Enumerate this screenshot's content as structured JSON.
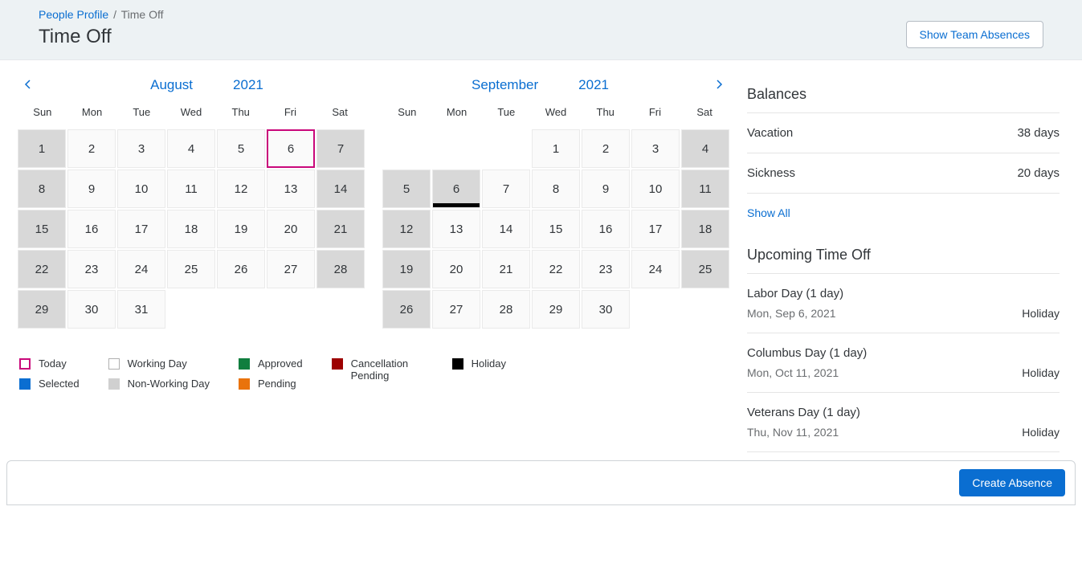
{
  "breadcrumb": {
    "parent": "People Profile",
    "current": "Time Off"
  },
  "page_title": "Time Off",
  "show_team_btn": "Show Team Absences",
  "dow": [
    "Sun",
    "Mon",
    "Tue",
    "Wed",
    "Thu",
    "Fri",
    "Sat"
  ],
  "months": [
    {
      "name": "August",
      "year": "2021",
      "weeks": [
        [
          {
            "d": 1,
            "t": "nonwork"
          },
          {
            "d": 2,
            "t": "work"
          },
          {
            "d": 3,
            "t": "work"
          },
          {
            "d": 4,
            "t": "work"
          },
          {
            "d": 5,
            "t": "work"
          },
          {
            "d": 6,
            "t": "today"
          },
          {
            "d": 7,
            "t": "nonwork"
          }
        ],
        [
          {
            "d": 8,
            "t": "nonwork"
          },
          {
            "d": 9,
            "t": "work"
          },
          {
            "d": 10,
            "t": "work"
          },
          {
            "d": 11,
            "t": "work"
          },
          {
            "d": 12,
            "t": "work"
          },
          {
            "d": 13,
            "t": "work"
          },
          {
            "d": 14,
            "t": "nonwork"
          }
        ],
        [
          {
            "d": 15,
            "t": "nonwork"
          },
          {
            "d": 16,
            "t": "work"
          },
          {
            "d": 17,
            "t": "work"
          },
          {
            "d": 18,
            "t": "work"
          },
          {
            "d": 19,
            "t": "work"
          },
          {
            "d": 20,
            "t": "work"
          },
          {
            "d": 21,
            "t": "nonwork"
          }
        ],
        [
          {
            "d": 22,
            "t": "nonwork"
          },
          {
            "d": 23,
            "t": "work"
          },
          {
            "d": 24,
            "t": "work"
          },
          {
            "d": 25,
            "t": "work"
          },
          {
            "d": 26,
            "t": "work"
          },
          {
            "d": 27,
            "t": "work"
          },
          {
            "d": 28,
            "t": "nonwork"
          }
        ],
        [
          {
            "d": 29,
            "t": "nonwork"
          },
          {
            "d": 30,
            "t": "work"
          },
          {
            "d": 31,
            "t": "work"
          },
          null,
          null,
          null,
          null
        ]
      ]
    },
    {
      "name": "September",
      "year": "2021",
      "weeks": [
        [
          null,
          null,
          null,
          {
            "d": 1,
            "t": "work"
          },
          {
            "d": 2,
            "t": "work"
          },
          {
            "d": 3,
            "t": "work"
          },
          {
            "d": 4,
            "t": "nonwork"
          }
        ],
        [
          {
            "d": 5,
            "t": "nonwork"
          },
          {
            "d": 6,
            "t": "nonwork holiday"
          },
          {
            "d": 7,
            "t": "work"
          },
          {
            "d": 8,
            "t": "work"
          },
          {
            "d": 9,
            "t": "work"
          },
          {
            "d": 10,
            "t": "work"
          },
          {
            "d": 11,
            "t": "nonwork"
          }
        ],
        [
          {
            "d": 12,
            "t": "nonwork"
          },
          {
            "d": 13,
            "t": "work"
          },
          {
            "d": 14,
            "t": "work"
          },
          {
            "d": 15,
            "t": "work"
          },
          {
            "d": 16,
            "t": "work"
          },
          {
            "d": 17,
            "t": "work"
          },
          {
            "d": 18,
            "t": "nonwork"
          }
        ],
        [
          {
            "d": 19,
            "t": "nonwork"
          },
          {
            "d": 20,
            "t": "work"
          },
          {
            "d": 21,
            "t": "work"
          },
          {
            "d": 22,
            "t": "work"
          },
          {
            "d": 23,
            "t": "work"
          },
          {
            "d": 24,
            "t": "work"
          },
          {
            "d": 25,
            "t": "nonwork"
          }
        ],
        [
          {
            "d": 26,
            "t": "nonwork"
          },
          {
            "d": 27,
            "t": "work"
          },
          {
            "d": 28,
            "t": "work"
          },
          {
            "d": 29,
            "t": "work"
          },
          {
            "d": 30,
            "t": "work"
          },
          null,
          null
        ]
      ]
    }
  ],
  "legend": {
    "today": "Today",
    "selected": "Selected",
    "working": "Working Day",
    "nonworking": "Non-Working Day",
    "approved": "Approved",
    "pending": "Pending",
    "cancel": "Cancellation Pending",
    "holiday": "Holiday"
  },
  "balances_title": "Balances",
  "balances": [
    {
      "label": "Vacation",
      "value": "38 days"
    },
    {
      "label": "Sickness",
      "value": "20 days"
    }
  ],
  "show_all": "Show All",
  "upcoming_title": "Upcoming Time Off",
  "upcoming": [
    {
      "title": "Labor Day (1 day)",
      "date": "Mon, Sep 6, 2021",
      "type": "Holiday"
    },
    {
      "title": "Columbus Day (1 day)",
      "date": "Mon, Oct 11, 2021",
      "type": "Holiday"
    },
    {
      "title": "Veterans Day (1 day)",
      "date": "Thu, Nov 11, 2021",
      "type": "Holiday"
    }
  ],
  "create_btn": "Create Absence"
}
